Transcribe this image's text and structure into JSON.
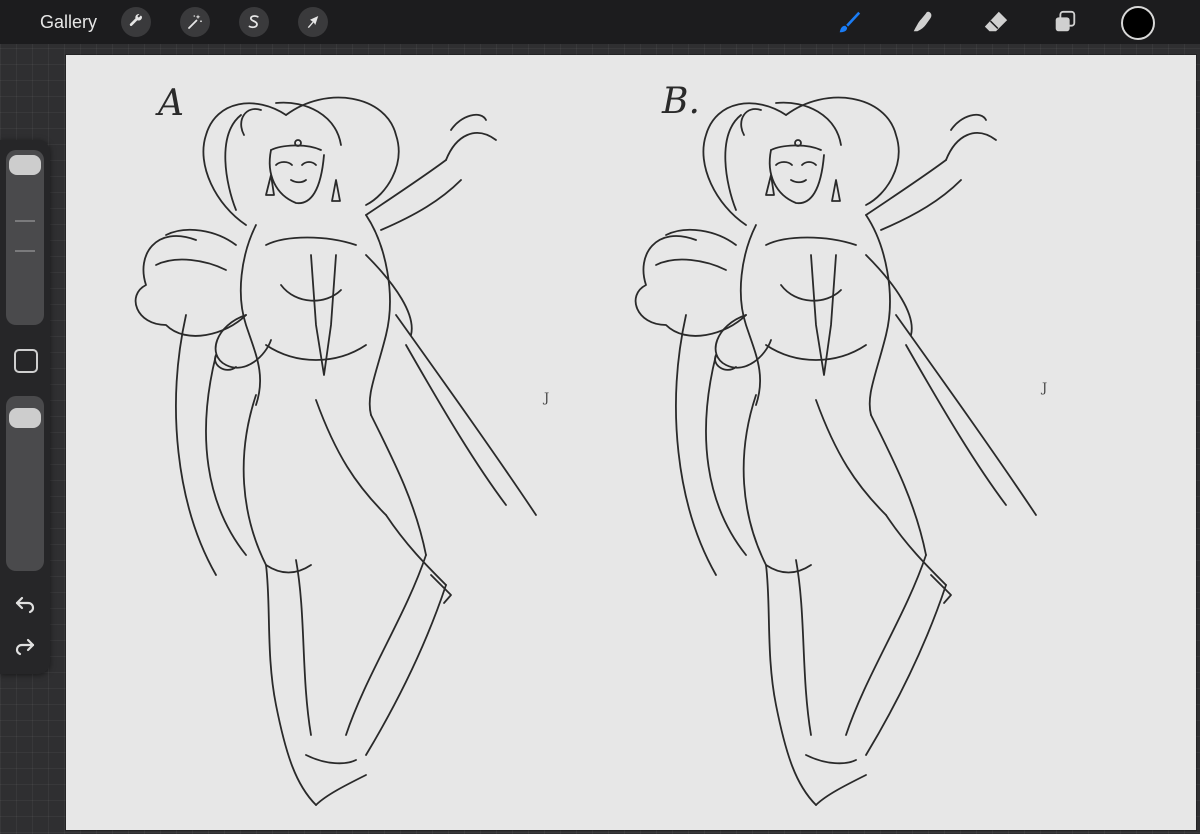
{
  "toolbar": {
    "gallery_label": "Gallery",
    "left_tools": [
      {
        "name": "actions",
        "icon": "wrench-icon"
      },
      {
        "name": "adjustments",
        "icon": "magic-wand-icon"
      },
      {
        "name": "selection",
        "icon": "selection-s-icon"
      },
      {
        "name": "transform",
        "icon": "arrow-cursor-icon"
      }
    ],
    "right_tools": [
      {
        "name": "brush",
        "icon": "brush-icon",
        "active": true
      },
      {
        "name": "smudge",
        "icon": "smudge-finger-icon",
        "active": false
      },
      {
        "name": "eraser",
        "icon": "eraser-icon",
        "active": false
      },
      {
        "name": "layers",
        "icon": "layers-icon",
        "active": false
      }
    ],
    "current_color": "#000000",
    "active_tool_color": "#1a7cf5"
  },
  "sidebar": {
    "brush_size_level": 0.0,
    "opacity_level": 0.0,
    "modify_icon": "square-icon",
    "undo_icon": "undo-arrow-icon",
    "redo_icon": "redo-arrow-icon"
  },
  "canvas": {
    "background_color": "#e7e7e7",
    "sketches": [
      {
        "label": "A",
        "stray_mark": "J"
      },
      {
        "label": "B.",
        "stray_mark": "J"
      }
    ]
  }
}
